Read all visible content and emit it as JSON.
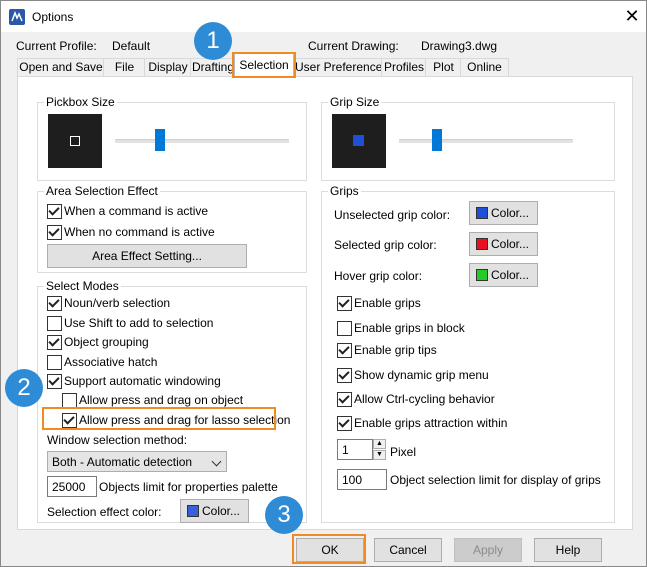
{
  "window": {
    "title": "Options",
    "close_symbol": "✕"
  },
  "profile": {
    "label": "Current Profile:",
    "value": "Default"
  },
  "drawing": {
    "label": "Current Drawing:",
    "value": "Drawing3.dwg"
  },
  "tabs": [
    "Open and Save",
    "File",
    "Display",
    "Drafting",
    "Selection",
    "User Preferences",
    "Profiles",
    "Plot",
    "Online"
  ],
  "active_tab": "Selection",
  "pickbox": {
    "title": "Pickbox Size",
    "slider_fraction": 0.26
  },
  "grip_size": {
    "title": "Grip Size",
    "slider_fraction": 0.22
  },
  "area_selection": {
    "title": "Area Selection Effect",
    "when_active": {
      "label": "When a command is active",
      "checked": true
    },
    "when_no_command": {
      "label": "When no command is active",
      "checked": true
    },
    "button_label": "Area Effect Setting..."
  },
  "select_modes": {
    "title": "Select Modes",
    "noun_verb": {
      "label": "Noun/verb selection",
      "checked": true
    },
    "use_shift": {
      "label": "Use Shift to add to selection",
      "checked": false
    },
    "object_grouping": {
      "label": "Object grouping",
      "checked": true
    },
    "assoc_hatch": {
      "label": "Associative hatch",
      "checked": false
    },
    "auto_windowing": {
      "label": "Support automatic windowing",
      "checked": true
    },
    "press_drag_object": {
      "label": "Allow press and drag on object",
      "checked": false
    },
    "press_drag_lasso": {
      "label": "Allow press and drag for lasso selection",
      "checked": true
    },
    "window_method_label": "Window selection method:",
    "window_method_value": "Both - Automatic detection",
    "objects_limit_value": "25000",
    "objects_limit_label": "Objects limit for properties palette",
    "effect_color_label": "Selection effect color:",
    "effect_color_button": "Color...",
    "effect_color": "#3a5fd9"
  },
  "grips": {
    "title": "Grips",
    "unselected": {
      "label": "Unselected grip color:",
      "button": "Color...",
      "color": "#1f4fd8"
    },
    "selected": {
      "label": "Selected grip color:",
      "button": "Color...",
      "color": "#e81123"
    },
    "hover": {
      "label": "Hover grip color:",
      "button": "Color...",
      "color": "#22cc22"
    },
    "enable_grips": {
      "label": "Enable grips",
      "checked": true
    },
    "grips_in_block": {
      "label": "Enable grips in block",
      "checked": false
    },
    "grip_tips": {
      "label": "Enable grip tips",
      "checked": true
    },
    "dynamic_menu": {
      "label": "Show dynamic grip menu",
      "checked": true
    },
    "ctrl_cycling": {
      "label": "Allow Ctrl-cycling behavior",
      "checked": true
    },
    "attraction": {
      "label": "Enable grips attraction within",
      "checked": true
    },
    "pixel_value": "1",
    "pixel_label": "Pixel",
    "limit_value": "100",
    "limit_label": "Object selection limit for display of grips"
  },
  "footer": {
    "ok": "OK",
    "cancel": "Cancel",
    "apply": "Apply",
    "help": "Help"
  },
  "callouts": [
    "1",
    "2",
    "3"
  ],
  "colors": {
    "accent": "#0078d7",
    "callout": "#2e8bd6",
    "highlight": "#f08a24"
  }
}
